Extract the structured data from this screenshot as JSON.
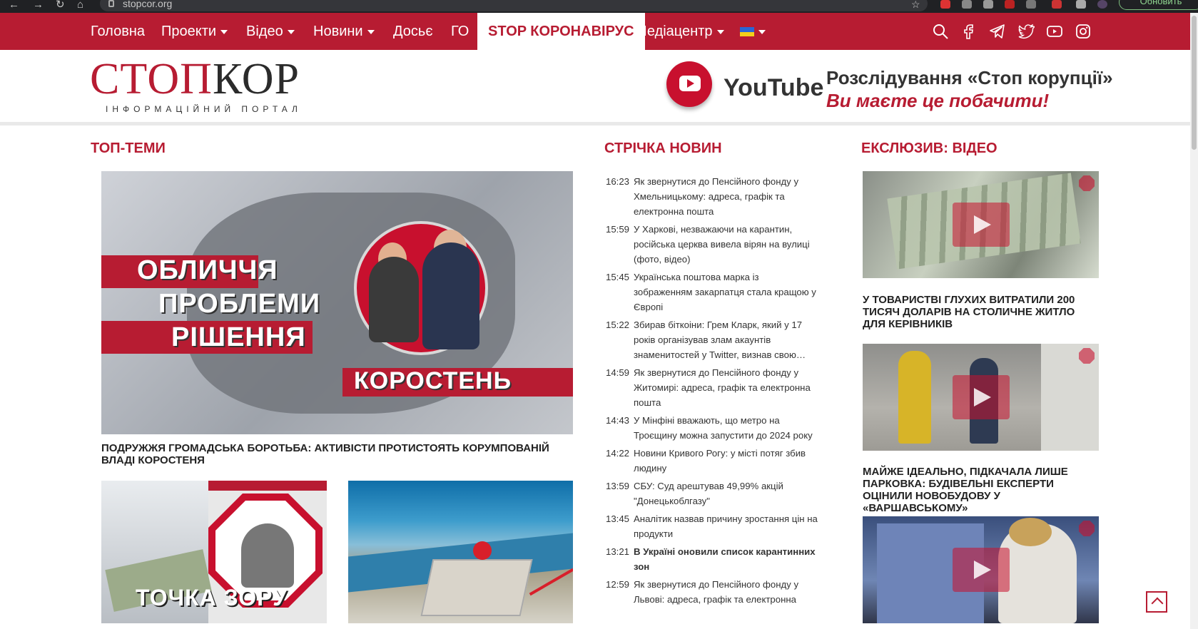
{
  "browser": {
    "url": "stopcor.org",
    "update_button": "Обновить"
  },
  "nav": {
    "items": [
      {
        "label": "Головна"
      },
      {
        "label": "Проекти"
      },
      {
        "label": "Відео"
      },
      {
        "label": "Новини"
      },
      {
        "label": "Досьє"
      },
      {
        "label": "ГО"
      },
      {
        "label": "STOP КОРОНАВІРУС"
      },
      {
        "label": "Медіацентр"
      }
    ],
    "social_icons": [
      "search-icon",
      "facebook-icon",
      "telegram-icon",
      "twitter-icon",
      "youtube-icon",
      "instagram-icon"
    ]
  },
  "header": {
    "logo_part1": "СТОП",
    "logo_part2": "КОР",
    "logo_tagline": "ІНФОРМАЦІЙНИЙ ПОРТАЛ",
    "banner": {
      "youtube": "YouTube",
      "line1": "Розслідування «Стоп корупції»",
      "line2": "Ви маєте це побачити!"
    }
  },
  "top_themes": {
    "title": "ТОП-ТЕМИ",
    "hero": {
      "overlay_line1": "ОБЛИЧЧЯ",
      "overlay_line2": "ПРОБЛЕМИ",
      "overlay_line3": "РІШЕННЯ",
      "overlay_city": "КОРОСТЕНЬ",
      "caption": "ПОДРУЖЖЯ ГРОМАДСЬКА БОРОТЬБА: АКТИВІСТИ ПРОТИСТОЯТЬ КОРУМПОВАНІЙ ВЛАДІ КОРОСТЕНЯ"
    },
    "thumb1_label": "ТОЧКА ЗОРУ"
  },
  "news_feed": {
    "title": "СТРІЧКА НОВИН",
    "items": [
      {
        "time": "16:23",
        "title": "Як звернутися до Пенсійного фонду у Хмельницькому: адреса, графік та електронна пошта",
        "bold": false
      },
      {
        "time": "15:59",
        "title": "У Харкові, незважаючи на карантин, російська церква вивела вірян на вулиці (фото, відео)",
        "bold": false
      },
      {
        "time": "15:45",
        "title": "Українська поштова марка із зображенням закарпатця стала кращою у Європі",
        "bold": false
      },
      {
        "time": "15:22",
        "title": "Збирав біткоіни: Грем Кларк, який у 17 років організував злам акаунтів знаменитостей у Twitter, визнав свою…",
        "bold": false
      },
      {
        "time": "14:59",
        "title": "Як звернутися до Пенсійного фонду у Житомирі: адреса, графік та електронна пошта",
        "bold": false
      },
      {
        "time": "14:43",
        "title": "У Мінфіні вважають, що метро на Троєщину можна запустити до 2024 року",
        "bold": false
      },
      {
        "time": "14:22",
        "title": "Новини Кривого Рогу: у місті потяг збив людину",
        "bold": false
      },
      {
        "time": "13:59",
        "title": "СБУ: Суд арештував 49,99% акцій \"Донецькоблгазу\"",
        "bold": false
      },
      {
        "time": "13:45",
        "title": "Аналітик назвав причину зростання цін на продукти",
        "bold": false
      },
      {
        "time": "13:21",
        "title": "В Україні оновили список карантинних зон",
        "bold": true
      },
      {
        "time": "12:59",
        "title": "Як звернутися до Пенсійного фонду у Львові: адреса, графік та електронна",
        "bold": false
      }
    ]
  },
  "exclusive": {
    "title": "ЕКСЛЮЗИВ: ВІДЕО",
    "videos": [
      {
        "caption": "У ТОВАРИСТВІ ГЛУХИХ ВИТРАТИЛИ 200 ТИСЯЧ ДОЛАРІВ НА СТОЛИЧНЕ ЖИТЛО ДЛЯ КЕРІВНИКІВ"
      },
      {
        "caption": "МАЙЖЕ ІДЕАЛЬНО, ПІДКАЧАЛА ЛИШЕ ПАРКОВКА: БУДІВЕЛЬНІ ЕКСПЕРТИ ОЦІНИЛИ НОВОБУДОВУ У «ВАРШАВСЬКОМУ»"
      },
      {
        "caption": ""
      }
    ]
  },
  "colors": {
    "brand_red": "#b71c32",
    "nav_text": "#ffffff"
  }
}
